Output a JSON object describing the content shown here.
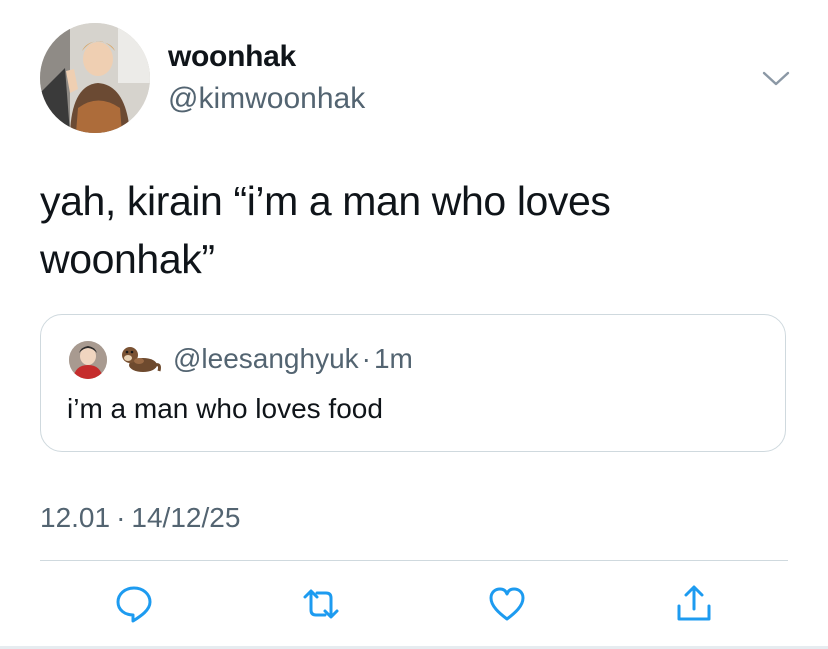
{
  "author": {
    "display_name": "woonhak",
    "handle": "@kimwoonhak"
  },
  "tweet": {
    "text_line1": "yah, kirain “i’m a man who loves",
    "text_line2": "woonhak”"
  },
  "quoted_tweet": {
    "handle": "@leesanghyuk",
    "separator": "·",
    "time": "1m",
    "emoji_icon": "otter-emoji-icon",
    "text": "i’m a man who loves food"
  },
  "timestamp": {
    "time": "12.01",
    "separator": "·",
    "date": "14/12/25"
  },
  "actions": [
    {
      "name": "reply",
      "icon": "speech-bubble-icon"
    },
    {
      "name": "retweet",
      "icon": "retweet-arrows-icon"
    },
    {
      "name": "like",
      "icon": "heart-icon"
    },
    {
      "name": "share",
      "icon": "share-upload-icon"
    }
  ],
  "colors": {
    "text_primary": "#0f1419",
    "text_secondary": "#536471",
    "border": "#cfd9de",
    "icon": "#1d9bf0"
  }
}
